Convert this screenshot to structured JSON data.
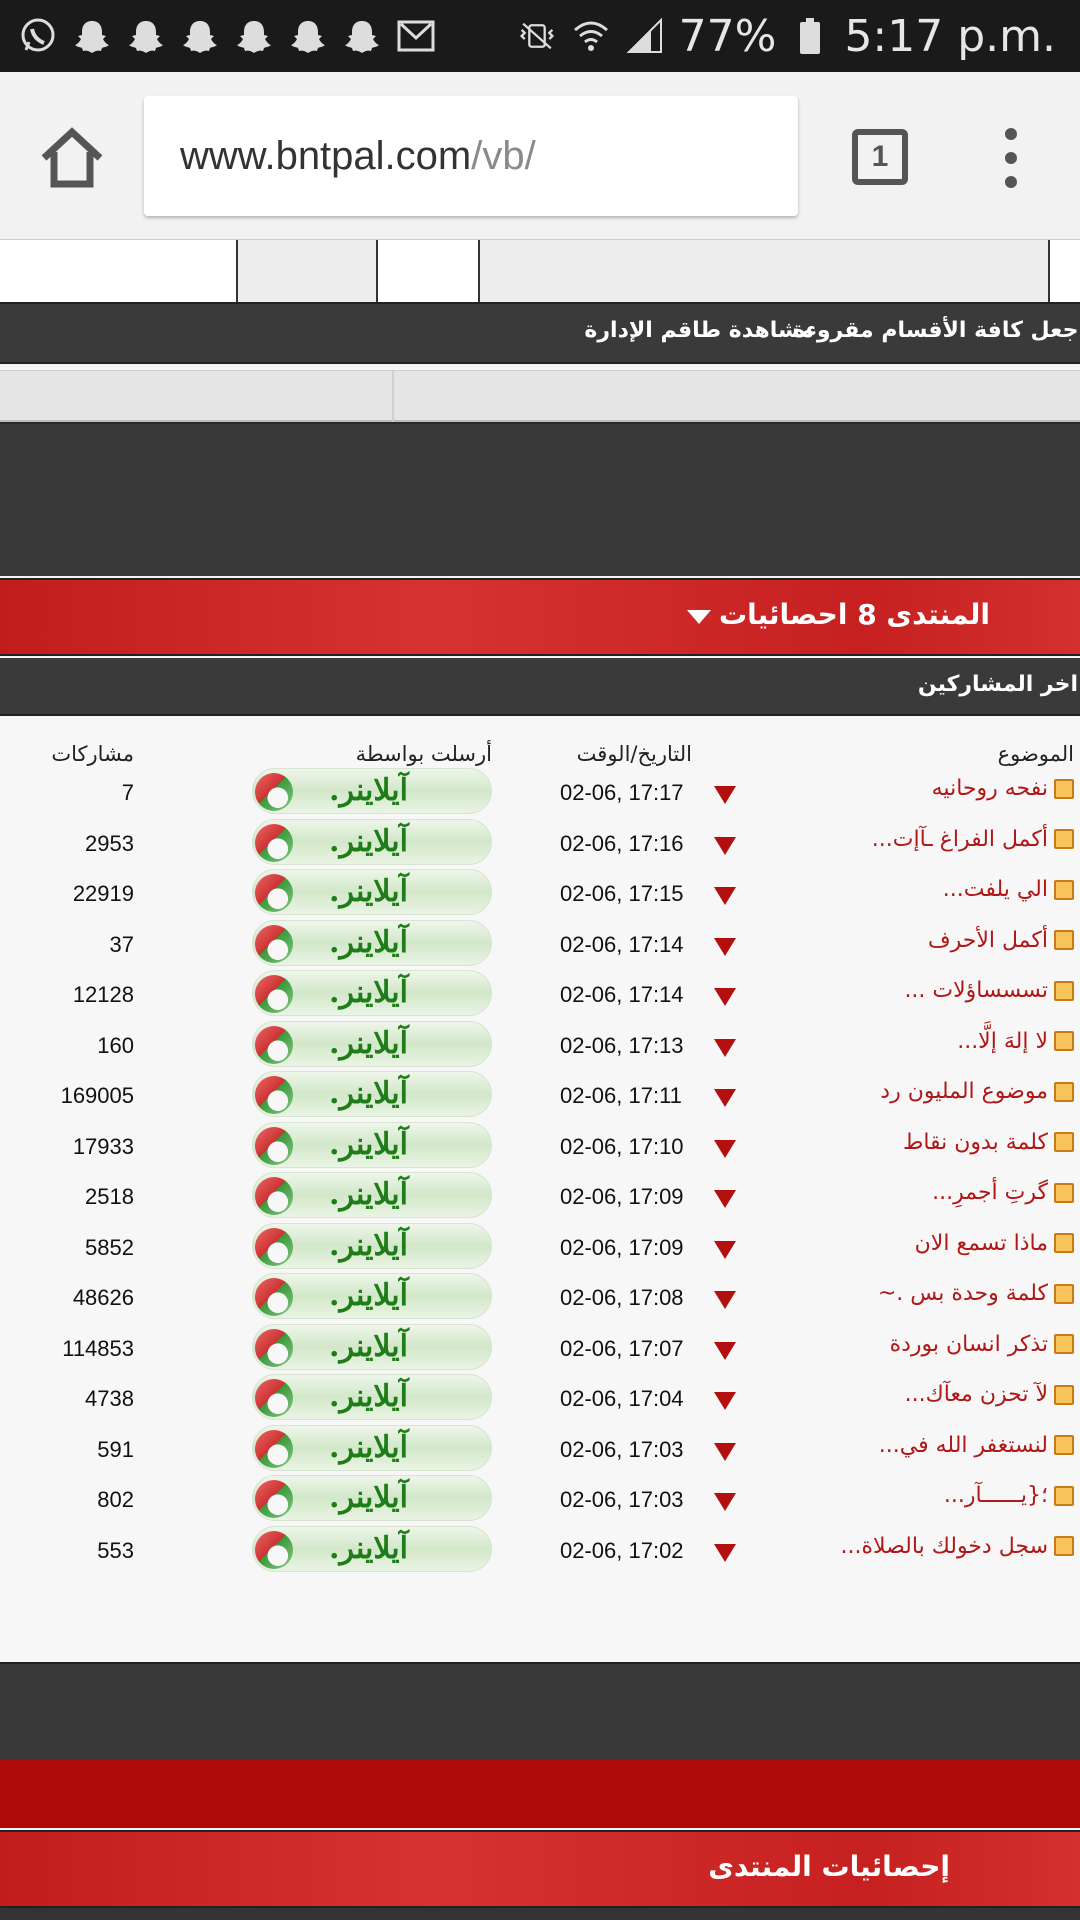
{
  "status_bar": {
    "notification_icons": [
      "whatsapp-icon",
      "snapchat-icon",
      "snapchat-icon",
      "snapchat-icon",
      "snapchat-icon",
      "snapchat-icon",
      "snapchat-icon",
      "gmail-icon"
    ],
    "battery": "77%",
    "time": "5:17 p.m."
  },
  "browser": {
    "url_domain": "www.bntpal.com",
    "url_path": "/vb/",
    "tab_count": "1"
  },
  "nav": {
    "mark_read": "اجعل كافة الأقسام مقروءة",
    "view_staff": "مشاهدة طاقم الإدارة"
  },
  "stats_section": {
    "title": "المنتدى 8 احصائيات",
    "subheader": "اخر المشاركين",
    "columns": {
      "topic": "الموضوع",
      "datetime": "التاريخ/الوقت",
      "sent_by": "أرسلت بواسطة",
      "posts": "مشاركات"
    },
    "rows": [
      {
        "topic": "نفحه روحانيه",
        "datetime": "02-06, 17:17",
        "user": "آيلاينر.",
        "posts": "7"
      },
      {
        "topic": "أكمل الفراغ ـآإت...",
        "datetime": "02-06, 17:16",
        "user": "آيلاينر.",
        "posts": "2953"
      },
      {
        "topic": "الي يلفت...",
        "datetime": "02-06, 17:15",
        "user": "آيلاينر.",
        "posts": "22919"
      },
      {
        "topic": "أكمل الأحرف",
        "datetime": "02-06, 17:14",
        "user": "آيلاينر.",
        "posts": "37"
      },
      {
        "topic": "تسسساؤلات ...",
        "datetime": "02-06, 17:14",
        "user": "آيلاينر.",
        "posts": "12128"
      },
      {
        "topic": "لا إلهَ إلَّا...",
        "datetime": "02-06, 17:13",
        "user": "آيلاينر.",
        "posts": "160"
      },
      {
        "topic": "موضوع المليون رد",
        "datetime": "02-06, 17:11",
        "user": "آيلاينر.",
        "posts": "169005"
      },
      {
        "topic": "كلمة بدون نقاط",
        "datetime": "02-06, 17:10",
        "user": "آيلاينر.",
        "posts": "17933"
      },
      {
        "topic": "گرتِ أجمرِ...",
        "datetime": "02-06, 17:09",
        "user": "آيلاينر.",
        "posts": "2518"
      },
      {
        "topic": "ماذا تسمع الان",
        "datetime": "02-06, 17:09",
        "user": "آيلاينر.",
        "posts": "5852"
      },
      {
        "topic": "كلمة وحدة بس .~",
        "datetime": "02-06, 17:08",
        "user": "آيلاينر.",
        "posts": "48626"
      },
      {
        "topic": "تذكر انسان بوردة",
        "datetime": "02-06, 17:07",
        "user": "آيلاينر.",
        "posts": "114853"
      },
      {
        "topic": "لآ تحزن معآك...",
        "datetime": "02-06, 17:04",
        "user": "آيلاينر.",
        "posts": "4738"
      },
      {
        "topic": "لنستغفر الله في...",
        "datetime": "02-06, 17:03",
        "user": "آيلاينر.",
        "posts": "591"
      },
      {
        "topic": "؛{يــــــآر...",
        "datetime": "02-06, 17:03",
        "user": "آيلاينر.",
        "posts": "802"
      },
      {
        "topic": "سجل دخولك بالصلاة...",
        "datetime": "02-06, 17:02",
        "user": "آيلاينر.",
        "posts": "553"
      }
    ]
  },
  "footer_section": {
    "title": "إحصائيات المنتدى"
  },
  "colors": {
    "red_bar": "#c62020",
    "dark_bar": "#3a3a3a",
    "topic_link": "#b01818",
    "username": "#1e7d18"
  }
}
